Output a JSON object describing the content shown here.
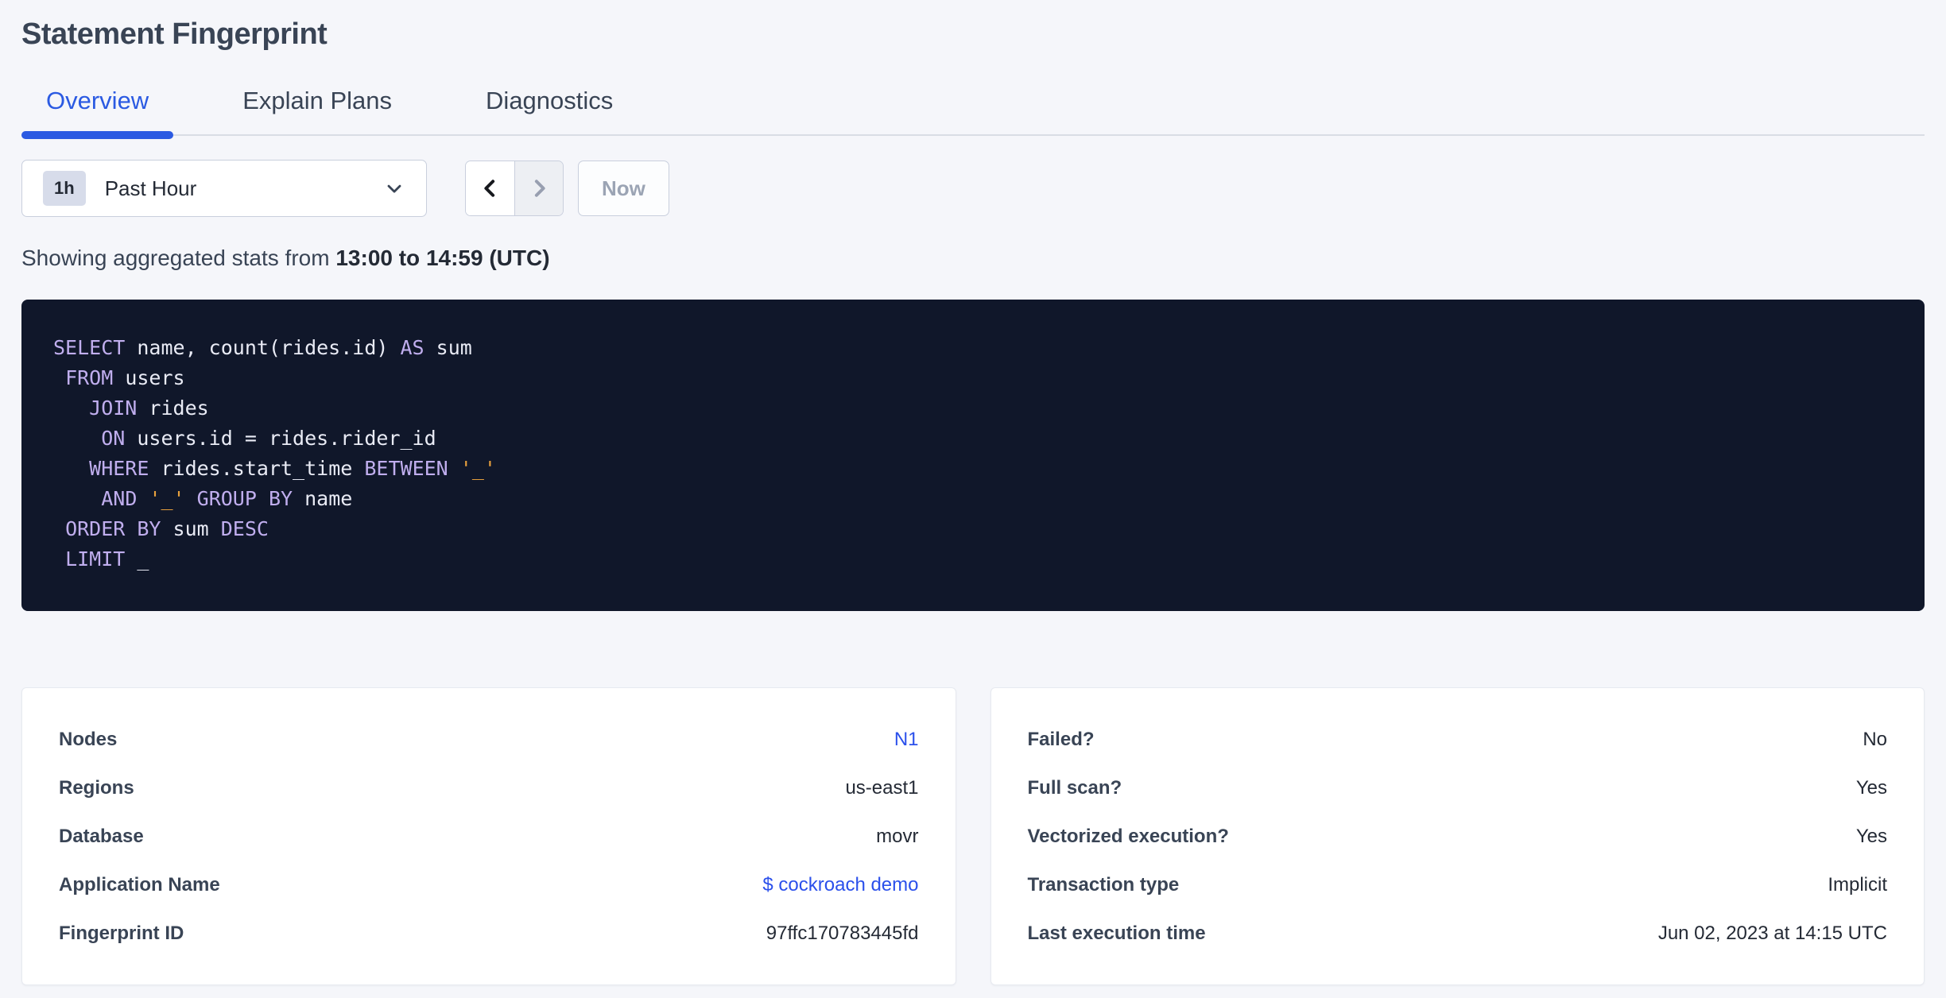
{
  "page": {
    "title": "Statement Fingerprint"
  },
  "tabs": [
    {
      "label": "Overview",
      "active": true
    },
    {
      "label": "Explain Plans",
      "active": false
    },
    {
      "label": "Diagnostics",
      "active": false
    }
  ],
  "time_controls": {
    "badge": "1h",
    "selected": "Past Hour",
    "now_label": "Now",
    "prev_enabled": true,
    "next_enabled": false
  },
  "stats_line": {
    "prefix": "Showing aggregated stats from ",
    "range_bold": "13:00 to 14:59 (UTC)"
  },
  "sql": {
    "lines": [
      [
        {
          "k": "kw",
          "v": "SELECT"
        },
        {
          "k": "id",
          "v": " name, count(rides.id) "
        },
        {
          "k": "kw",
          "v": "AS"
        },
        {
          "k": "id",
          "v": " sum"
        }
      ],
      [
        {
          "k": "id",
          "v": " "
        },
        {
          "k": "kw",
          "v": "FROM"
        },
        {
          "k": "id",
          "v": " users"
        }
      ],
      [
        {
          "k": "id",
          "v": "   "
        },
        {
          "k": "kw",
          "v": "JOIN"
        },
        {
          "k": "id",
          "v": " rides"
        }
      ],
      [
        {
          "k": "id",
          "v": "    "
        },
        {
          "k": "kw",
          "v": "ON"
        },
        {
          "k": "id",
          "v": " users.id = rides.rider_id"
        }
      ],
      [
        {
          "k": "id",
          "v": "   "
        },
        {
          "k": "kw",
          "v": "WHERE"
        },
        {
          "k": "id",
          "v": " rides.start_time "
        },
        {
          "k": "kw",
          "v": "BETWEEN"
        },
        {
          "k": "id",
          "v": " "
        },
        {
          "k": "str",
          "v": "'_'"
        }
      ],
      [
        {
          "k": "id",
          "v": "    "
        },
        {
          "k": "kw",
          "v": "AND"
        },
        {
          "k": "id",
          "v": " "
        },
        {
          "k": "str",
          "v": "'_'"
        },
        {
          "k": "id",
          "v": " "
        },
        {
          "k": "kw",
          "v": "GROUP BY"
        },
        {
          "k": "id",
          "v": " name"
        }
      ],
      [
        {
          "k": "id",
          "v": " "
        },
        {
          "k": "kw",
          "v": "ORDER BY"
        },
        {
          "k": "id",
          "v": " sum "
        },
        {
          "k": "kw",
          "v": "DESC"
        }
      ],
      [
        {
          "k": "id",
          "v": " "
        },
        {
          "k": "kw",
          "v": "LIMIT"
        },
        {
          "k": "id",
          "v": " _"
        }
      ]
    ]
  },
  "cards": {
    "left": {
      "rows": [
        {
          "label": "Nodes",
          "value": "N1",
          "link": true
        },
        {
          "label": "Regions",
          "value": "us-east1",
          "link": false
        },
        {
          "label": "Database",
          "value": "movr",
          "link": false
        },
        {
          "label": "Application Name",
          "value": "$ cockroach demo",
          "link": true
        },
        {
          "label": "Fingerprint ID",
          "value": "97ffc170783445fd",
          "link": false
        }
      ]
    },
    "right": {
      "rows": [
        {
          "label": "Failed?",
          "value": "No",
          "link": false
        },
        {
          "label": "Full scan?",
          "value": "Yes",
          "link": false
        },
        {
          "label": "Vectorized execution?",
          "value": "Yes",
          "link": false
        },
        {
          "label": "Transaction type",
          "value": "Implicit",
          "link": false
        },
        {
          "label": "Last execution time",
          "value": "Jun 02, 2023 at 14:15 UTC",
          "link": false
        }
      ]
    }
  },
  "icons": {
    "dropdown_chevron": "chevron-down-icon",
    "prev": "chevron-left-icon",
    "next": "chevron-right-icon"
  },
  "colors": {
    "page_background": "#f5f6fa",
    "accent_blue": "#2b5ae2",
    "link_blue": "#2b50eb",
    "heading_text": "#394455",
    "body_text": "#242a35",
    "sql_background": "#10172a",
    "sql_keyword": "#c0aeee",
    "sql_identifier": "#e9ebf5",
    "sql_string": "#e9a13e",
    "disabled_text": "#9ba4b4",
    "border": "#c9cfdd"
  }
}
